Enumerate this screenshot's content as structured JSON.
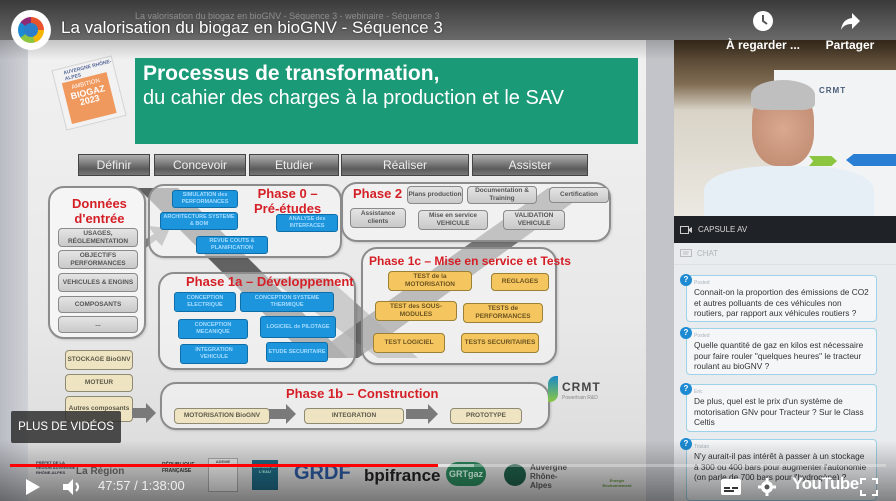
{
  "player": {
    "video_title": "La valorisation du biogaz en bioGNV - Séquence 3",
    "ghost_title": "La valorisation du biogaz en bioGNV - Séquence 3 - webinaire - Séquence 3",
    "watch_later_label": "À regarder ...",
    "share_label": "Partager",
    "more_videos_label": "PLUS DE VIDÉOS",
    "time_current": "47:57",
    "time_total": "1:38:00",
    "time_display": "47:57 / 1:38:00",
    "progress_played_fraction": 0.489,
    "progress_loaded_fraction": 0.53,
    "youtube_label": "YouTube",
    "accent_color": "#ff0000"
  },
  "slide": {
    "badge": {
      "org": "AUVERGNE RHÔNE-ALPES",
      "line1": "AMBITION",
      "line2": "BIOGAZ",
      "line3": "2023"
    },
    "title_bold": "Processus de transformation,",
    "title_rest": "du cahier des charges à la production et le SAV",
    "title_bg_color": "#1b9a78",
    "steps": [
      "Définir",
      "Concevoir",
      "Etudier",
      "Réaliser",
      "Assister"
    ],
    "inputs": {
      "title_line1": "Données",
      "title_line2": "d'entrée",
      "items": [
        "USAGES, RÉGLEMENTATION",
        "OBJECTIFS PERFORMANCES",
        "VEHICULES & ENGINS",
        "COMPOSANTS",
        "..."
      ]
    },
    "components": [
      "STOCKAGE BioGNV",
      "MOTEUR",
      "Autres composants"
    ],
    "phase0": {
      "title_line1": "Phase 0 –",
      "title_line2": "Pré-études",
      "items": [
        "SIMULATION des PERFORMANCES",
        "ARCHITECTURE SYSTEME & BOM",
        "ANALYSE des INTERFACES",
        "REVUE COUTS & PLANIFICATION"
      ]
    },
    "phase2": {
      "title": "Phase 2",
      "items": [
        "Plans production",
        "Documentation & Training",
        "Certification",
        "Assistance clients",
        "Mise en service VEHICULE",
        "VALIDATION VEHICULE"
      ]
    },
    "phase1a": {
      "title": "Phase 1a – Développement",
      "items": [
        "CONCEPTION ELECTRIQUE",
        "CONCEPTION SYSTEME THERMIQUE",
        "CONCEPTION MECANIQUE",
        "LOGICIEL de PILOTAGE",
        "INTEGRATION VEHICULE",
        "ETUDE SECURITAIRE"
      ]
    },
    "phase1c": {
      "title": "Phase 1c – Mise en service et Tests",
      "items": [
        "TEST de la MOTORISATION",
        "REGLAGES",
        "TEST des SOUS-MODULES",
        "TESTS de PERFORMANCES",
        "TEST LOGICIEL",
        "TESTS SECURITAIRES"
      ]
    },
    "phase1b": {
      "title": "Phase 1b – Construction",
      "items": [
        "MOTORISATION BioGNV",
        "INTEGRATION",
        "PROTOTYPE"
      ]
    },
    "crmt_logo": "CRMT",
    "crmt_sub": "Powertrain R&D",
    "sponsors": [
      "PRÉFET DE LA RÉGION AUVERGNE RHÔNE-ALPES",
      "La Région",
      "RÉPUBLIQUE FRANÇAISE",
      "ADEME",
      "AGENCE DE L'EAU",
      "GRDF",
      "bpifrance",
      "GRTgaz",
      "Auvergne Rhône-Alpes",
      "Énergie Environnement"
    ]
  },
  "sidebar": {
    "webcam_logo": "CRMT",
    "capsule_label": "CAPSULE AV",
    "chat_label": "CHAT",
    "messages": [
      {
        "author": "Posted",
        "text": "Connait-on la proportion des émissions de CO2 et autres polluants de ces véhicules non routiers, par rapport aux véhicules routiers ?"
      },
      {
        "author": "Posted",
        "text": "Quelle quantité de gaz en kilos est nécessaire pour faire rouler \"quelques heures\" le tracteur roulant au bioGNV ?"
      },
      {
        "author": "Eric",
        "text": "De plus, quel est le prix d'un système de motorisation GNv pour Tracteur ? Sur le Class Celtis"
      },
      {
        "author": "Tristan",
        "text": "N'y aurait-il pas intérêt à passer à un stockage à 300 ou 400 bars pour augmenter l'autonomie (on parle de 700 bars pour l'hydrogène) ?"
      }
    ]
  }
}
